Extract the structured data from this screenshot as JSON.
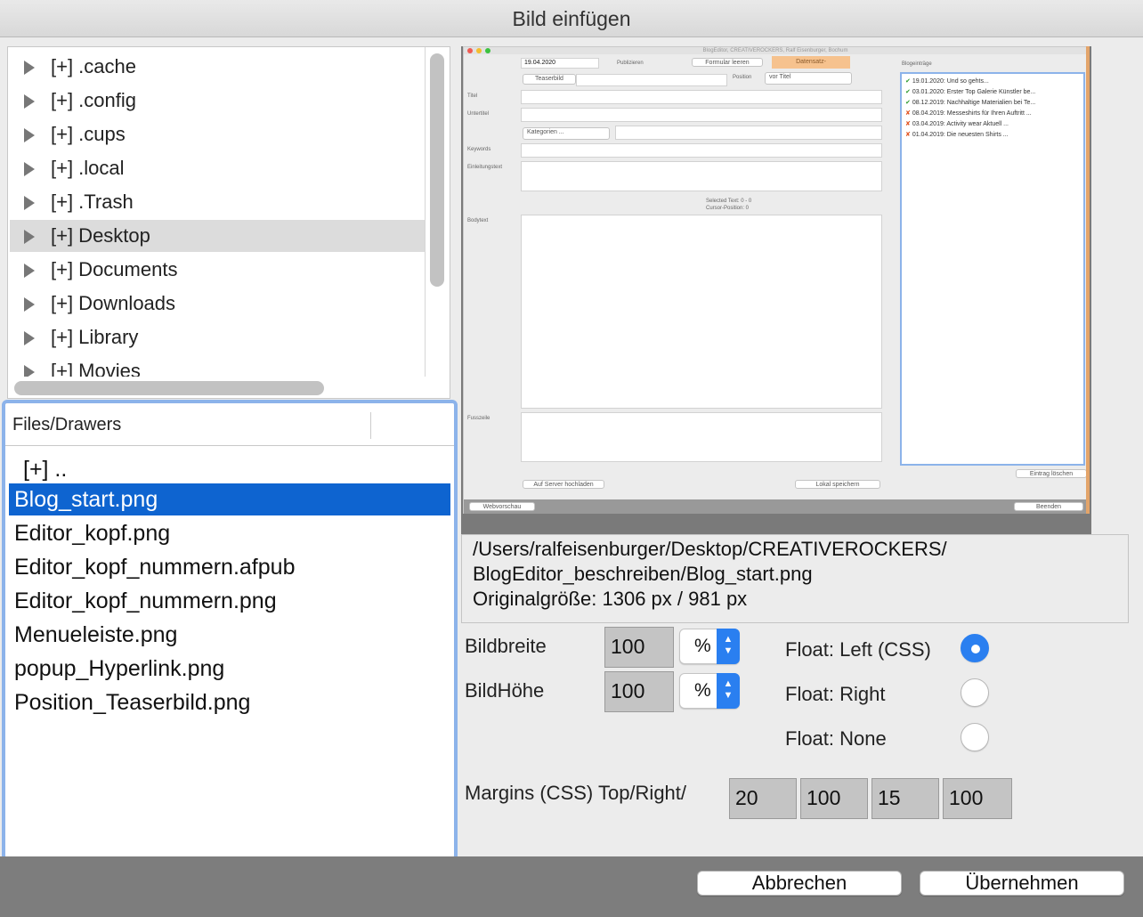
{
  "window": {
    "title": "Bild einfügen"
  },
  "tree": {
    "items": [
      {
        "label": "[+] .cache"
      },
      {
        "label": "[+] .config"
      },
      {
        "label": "[+] .cups"
      },
      {
        "label": "[+] .local"
      },
      {
        "label": "[+] .Trash"
      },
      {
        "label": "[+] Desktop"
      },
      {
        "label": "[+] Documents"
      },
      {
        "label": "[+] Downloads"
      },
      {
        "label": "[+] Library"
      },
      {
        "label": "[+] Movies"
      }
    ],
    "selected": "[+] Desktop"
  },
  "files": {
    "header": "Files/Drawers",
    "rows": [
      {
        "label": "[+] .."
      },
      {
        "label": "Blog_start.png"
      },
      {
        "label": "Editor_kopf.png"
      },
      {
        "label": "Editor_kopf_nummern.afpub"
      },
      {
        "label": "Editor_kopf_nummern.png"
      },
      {
        "label": "Menueleiste.png"
      },
      {
        "label": "popup_Hyperlink.png"
      },
      {
        "label": "Position_Teaserbild.png"
      }
    ],
    "selected": "Blog_start.png"
  },
  "preview": {
    "titlebar": "BlogEditor, CREATIVEROCKERS, Ralf Eisenburger, Bochum",
    "date": "19.04.2020",
    "publizieren": "Publizieren",
    "formular_leeren": "Formular leeren",
    "datensatz": "Datensatz-",
    "teaserbild": "Teaserbild",
    "position": "Position",
    "vor_titel": "vor Titel",
    "titel": "Titel",
    "untertitel": "Untertitel",
    "kategorien": "Kategorien ...",
    "keywords": "Keywords",
    "einleitungstext": "Einleitungstext",
    "bodytext": "Bodytext",
    "selected_text": "Selected Text: 0 - 0",
    "cursor_position": "Cursor-Position: 0",
    "fusszeile": "Fusszeile",
    "auf_server": "Auf Server hochladen",
    "lokal_speichern": "Lokal speichern",
    "blogeintraege": "Blogeinträge",
    "entries": [
      "19.01.2020: Und so gehts...",
      "03.01.2020: Erster Top Galerie Künstler be...",
      "08.12.2019: Nachhaltige Materialien bei Te...",
      "08.04.2019: Messeshirts für Ihren Auftritt ...",
      "03.04.2019: Activity wear Aktuell ...",
      "01.04.2019: Die neuesten Shirts ..."
    ],
    "eintrag_loeschen": "Eintrag löschen",
    "webvorschau": "Webvorschau",
    "beenden": "Beenden"
  },
  "info": {
    "path_line1": "/Users/ralfeisenburger/Desktop/CREATIVEROCKERS/",
    "path_line2": "BlogEditor_beschreiben/Blog_start.png",
    "original_size": "Originalgröße: 1306 px / 981 px"
  },
  "size": {
    "width_label": "Bildbreite",
    "width_value": "100",
    "width_unit": "%",
    "height_label": "BildHöhe",
    "height_value": "100",
    "height_unit": "%"
  },
  "float": {
    "left_label": "Float: Left (CSS)",
    "right_label": "Float: Right",
    "none_label": "Float: None",
    "selected": "left"
  },
  "margins": {
    "label": "Margins (CSS) Top/Right/",
    "top": "20",
    "right": "100",
    "bottom": "15",
    "left": "100"
  },
  "buttons": {
    "cancel": "Abbrechen",
    "apply": "Übernehmen"
  },
  "colors": {
    "accent": "#2a7ff0",
    "selection": "#0e64d0",
    "focus_ring": "#8cb3ea"
  }
}
